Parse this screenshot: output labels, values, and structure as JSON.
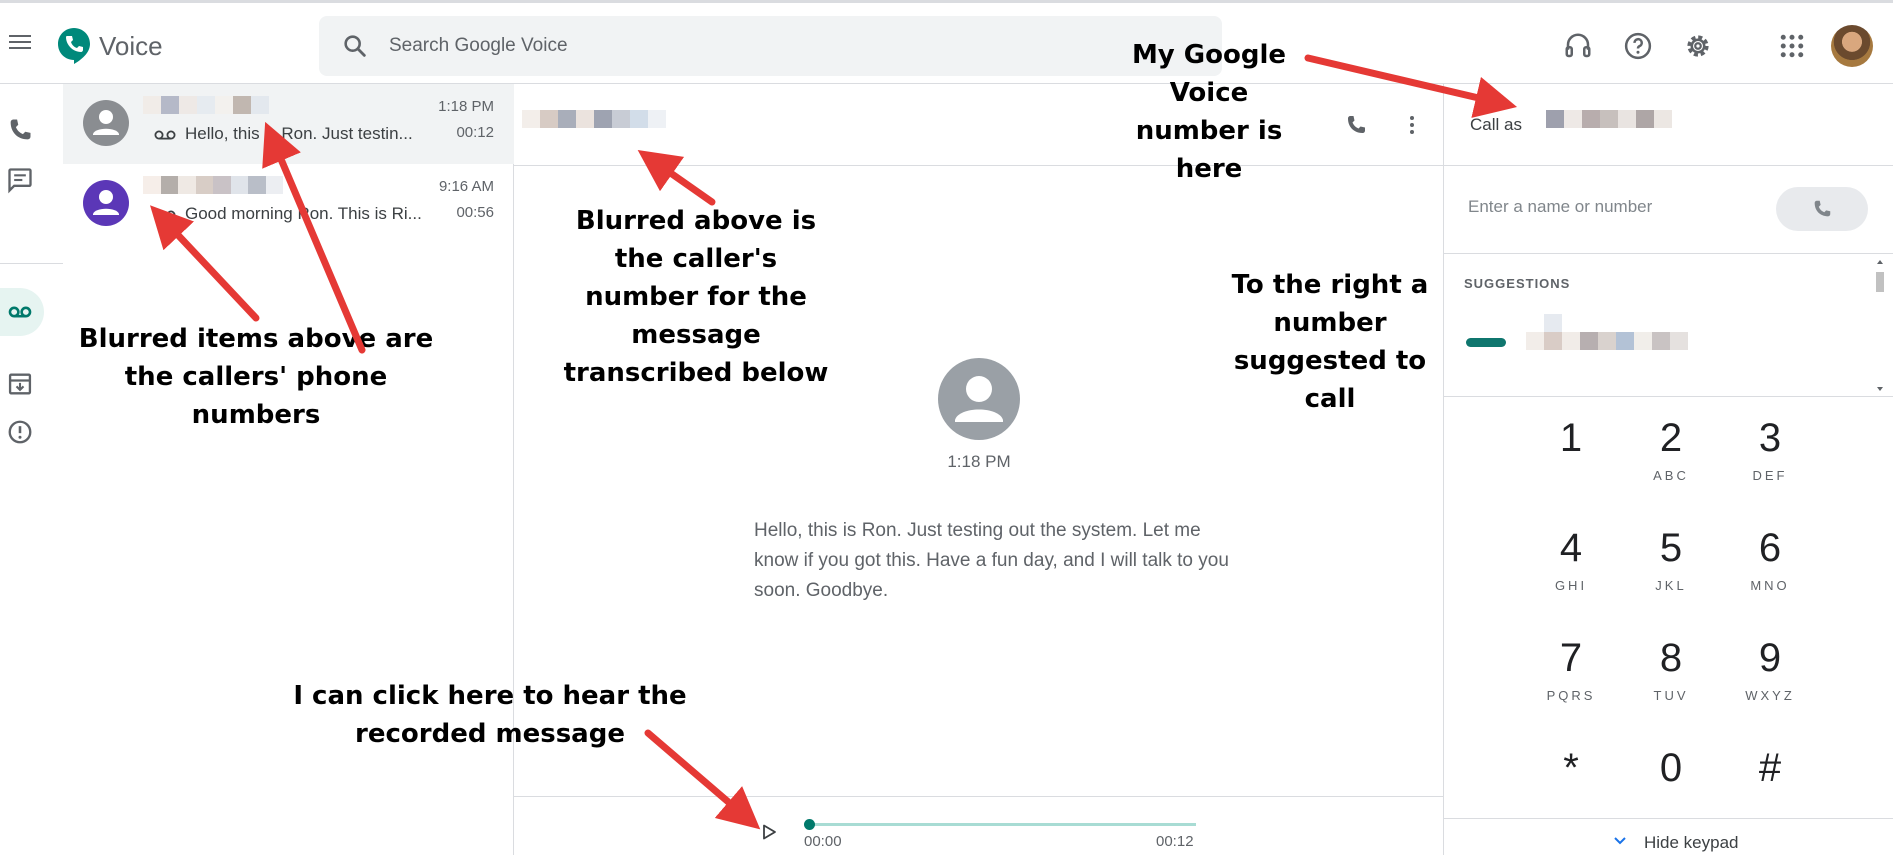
{
  "app": {
    "title": "Voice"
  },
  "search": {
    "placeholder": "Search Google Voice"
  },
  "header_icons": [
    "support-headset-icon",
    "help-icon",
    "settings-gear-icon",
    "apps-grid-icon"
  ],
  "rail": {
    "items": [
      {
        "name": "calls",
        "icon": "phone-icon"
      },
      {
        "name": "messages",
        "icon": "message-icon"
      },
      {
        "name": "voicemail",
        "icon": "voicemail-icon",
        "active": true
      },
      {
        "name": "archive",
        "icon": "archive-icon"
      },
      {
        "name": "spam",
        "icon": "spam-icon"
      }
    ]
  },
  "conversations": [
    {
      "time": "1:18 PM",
      "duration": "00:12",
      "preview": "Hello, this is Ron. Just testin...",
      "avatar_color": "#8a8d91",
      "selected": true
    },
    {
      "time": "9:16 AM",
      "duration": "00:56",
      "preview": "Good morning Ron. This is Ri...",
      "avatar_color": "#5b37b7",
      "selected": false
    }
  ],
  "thread": {
    "message_time": "1:18 PM",
    "transcript": "Hello, this is Ron. Just testing out the system. Let me know if you got this. Have a fun day, and I will talk to you soon. Goodbye.",
    "player": {
      "position": "00:00",
      "length": "00:12",
      "progress": 0
    }
  },
  "dialer": {
    "call_as_label": "Call as",
    "input_placeholder": "Enter a name or number",
    "suggestions_title": "SUGGESTIONS",
    "keys": [
      {
        "digit": "1",
        "letters": ""
      },
      {
        "digit": "2",
        "letters": "ABC"
      },
      {
        "digit": "3",
        "letters": "DEF"
      },
      {
        "digit": "4",
        "letters": "GHI"
      },
      {
        "digit": "5",
        "letters": "JKL"
      },
      {
        "digit": "6",
        "letters": "MNO"
      },
      {
        "digit": "7",
        "letters": "PQRS"
      },
      {
        "digit": "8",
        "letters": "TUV"
      },
      {
        "digit": "9",
        "letters": "WXYZ"
      },
      {
        "digit": "*",
        "letters": ""
      },
      {
        "digit": "0",
        "letters": ""
      },
      {
        "digit": "#",
        "letters": ""
      }
    ],
    "hide_keypad_label": "Hide keypad"
  },
  "annotations": {
    "callers_numbers": "Blurred items above are the callers' phone numbers",
    "caller_number": "Blurred above is the caller's number for the message transcribed below",
    "my_number": "My Google Voice number is here",
    "suggested": "To the right a number suggested to call",
    "play": "I can click here to hear the recorded message"
  },
  "colors": {
    "accent": "#00796b",
    "arrow": "#e53935"
  }
}
